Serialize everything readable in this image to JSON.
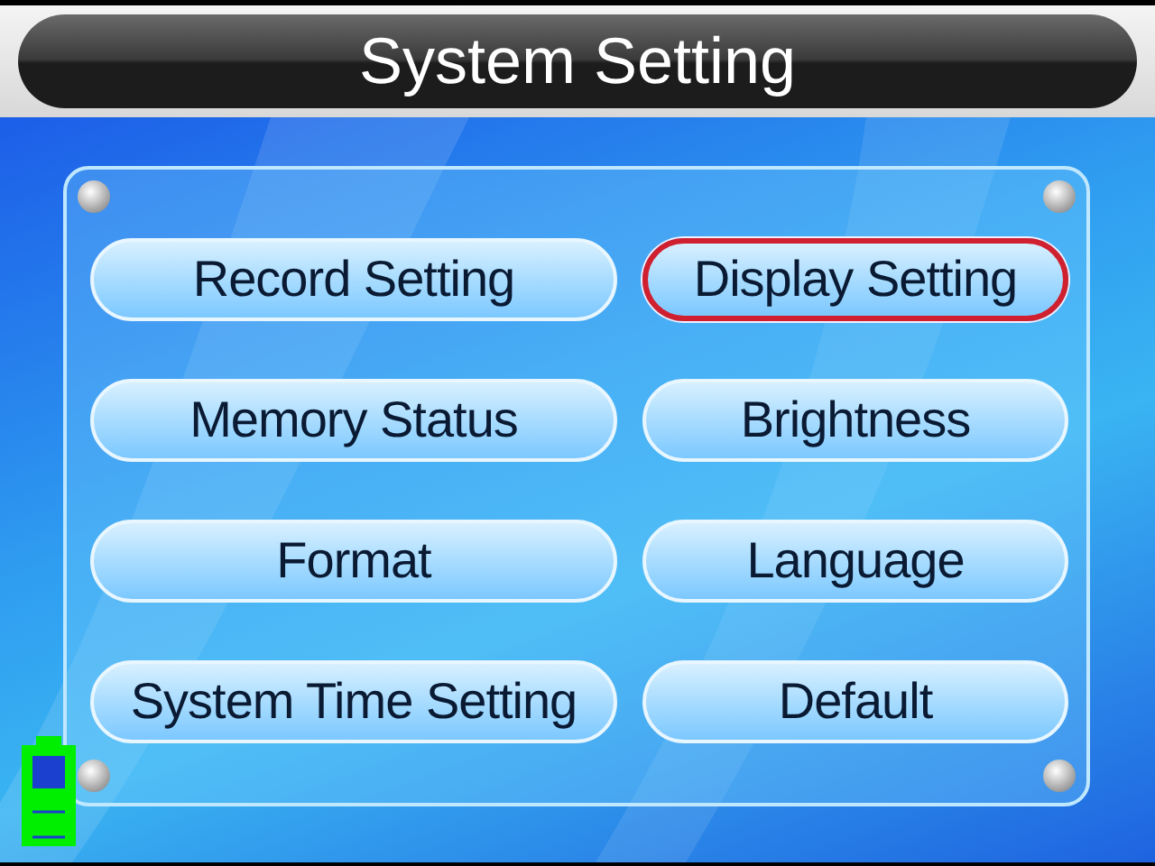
{
  "title": "System Setting",
  "buttons": [
    {
      "label": "Record Setting",
      "selected": false
    },
    {
      "label": "Display Setting",
      "selected": true
    },
    {
      "label": "Memory Status",
      "selected": false
    },
    {
      "label": "Brightness",
      "selected": false
    },
    {
      "label": "Format",
      "selected": false
    },
    {
      "label": "Language",
      "selected": false
    },
    {
      "label": "System Time Setting",
      "selected": false
    },
    {
      "label": "Default",
      "selected": false
    }
  ]
}
